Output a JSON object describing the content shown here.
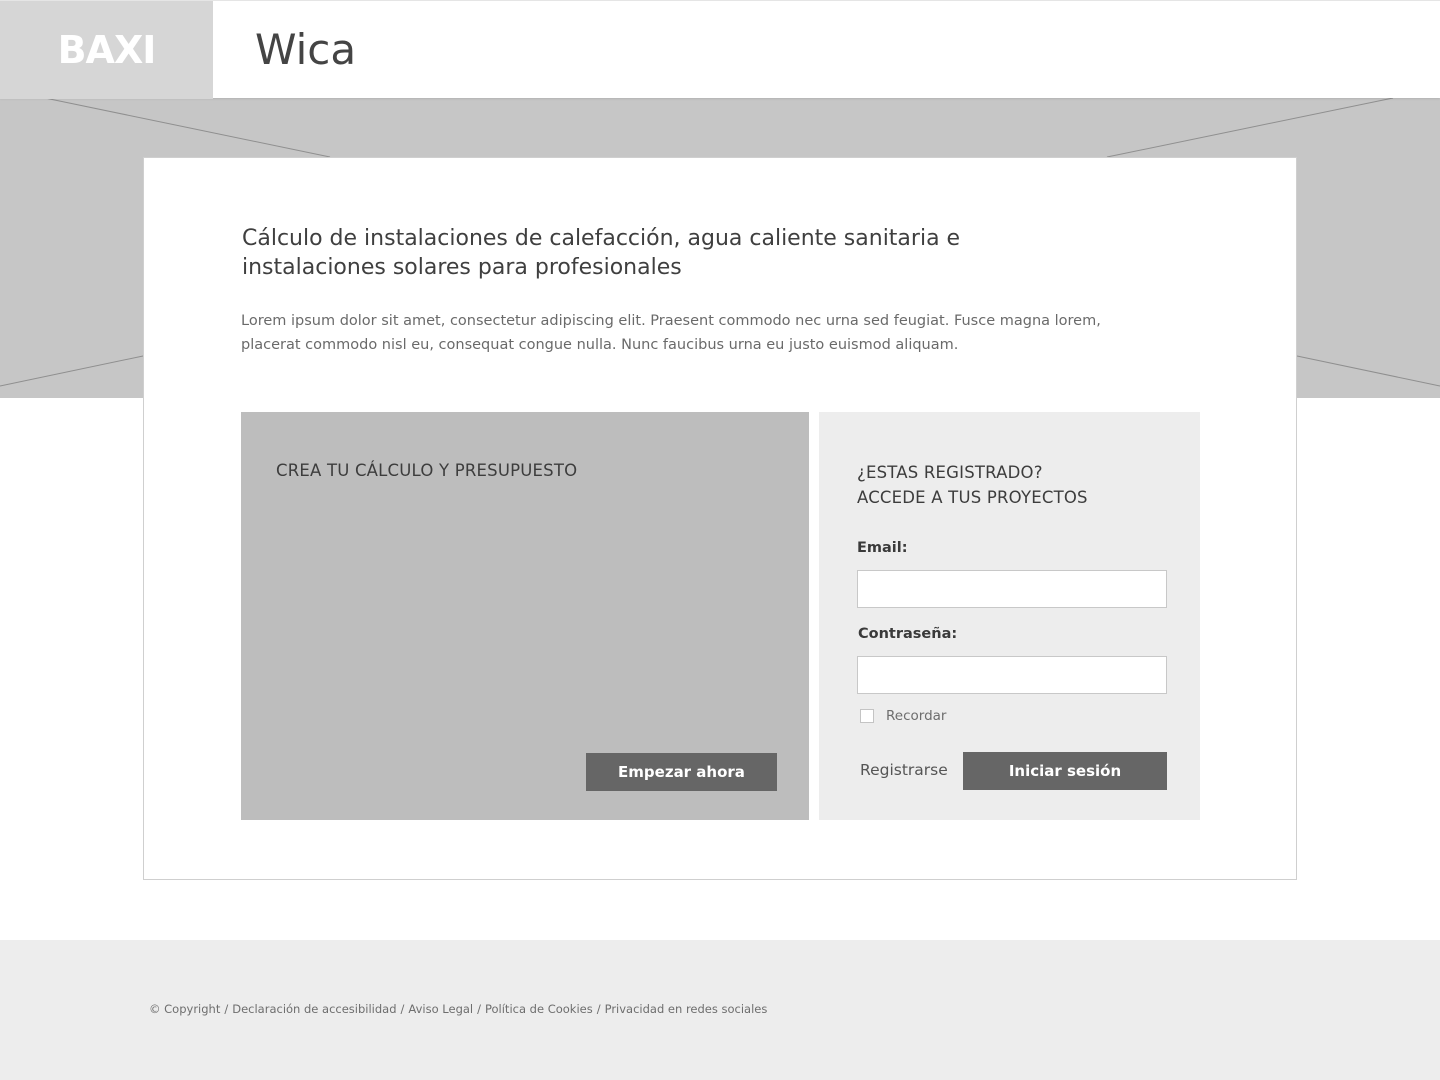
{
  "header": {
    "logo": "BAXI",
    "app_title": "Wica"
  },
  "main": {
    "headline": "Cálculo de instalaciones de calefacción, agua caliente sanitaria e instalaciones solares para profesionales",
    "intro": "Lorem ipsum dolor sit amet, consectetur adipiscing elit. Praesent commodo nec urna sed feugiat. Fusce magna lorem, placerat commodo nisl eu, consequat congue nulla. Nunc faucibus urna eu justo euismod aliquam."
  },
  "create_panel": {
    "title": "CREA TU CÁLCULO Y PRESUPUESTO",
    "button": "Empezar ahora"
  },
  "login_panel": {
    "title_line1": "¿ESTAS REGISTRADO?",
    "title_line2": "ACCEDE A TUS PROYECTOS",
    "email_label": "Email:",
    "email_value": "",
    "password_label": "Contraseña:",
    "password_value": "",
    "remember_label": "Recordar",
    "remember_checked": false,
    "register_link": "Registrarse",
    "login_button": "Iniciar sesión"
  },
  "footer": {
    "links": [
      "© Copyright",
      "Declaración de accesibilidad",
      "Aviso Legal",
      "Política de Cookies",
      "Privacidad en redes sociales"
    ],
    "separator": "/"
  },
  "colors": {
    "logo_bg": "#d6d6d6",
    "hero_bg": "#c6c6c6",
    "panel_dark": "#bdbdbd",
    "panel_light": "#ededed",
    "button_bg": "#666666",
    "footer_bg": "#ededed"
  }
}
